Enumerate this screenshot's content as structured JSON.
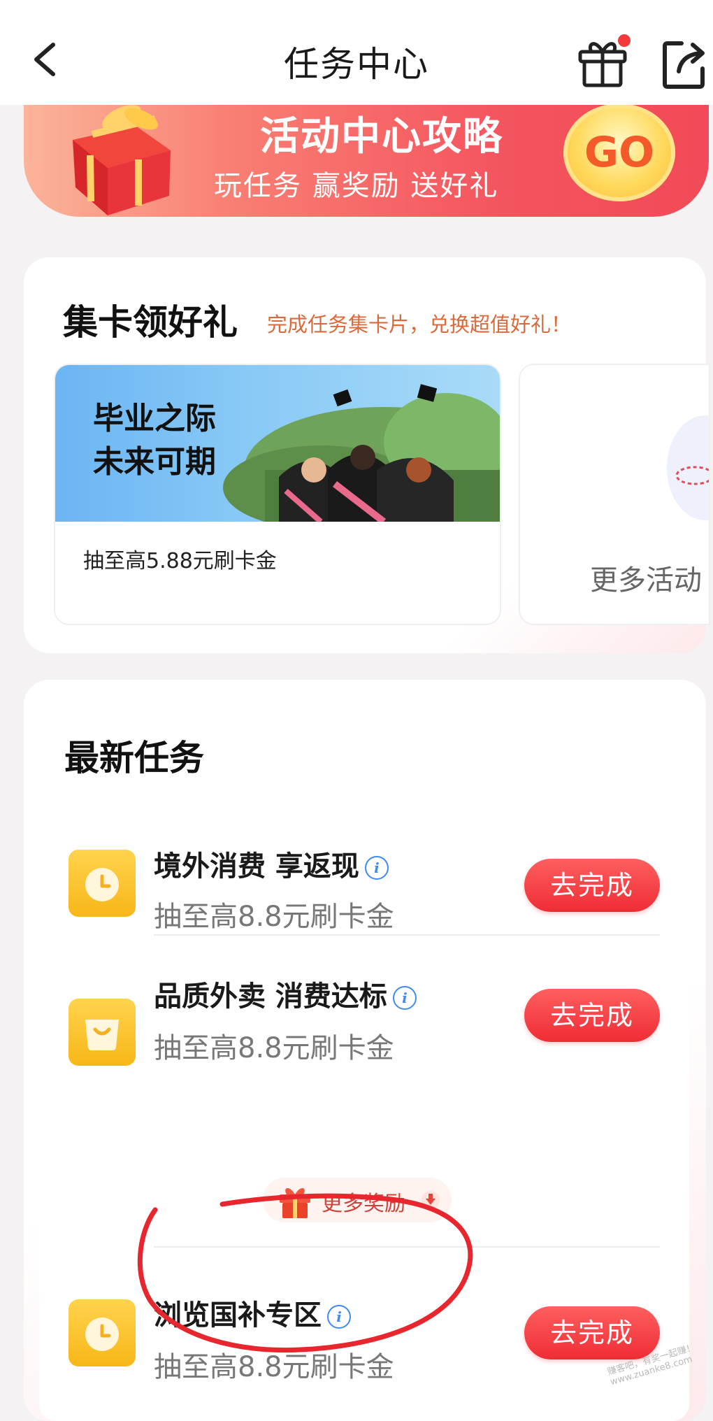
{
  "header": {
    "title": "任务中心"
  },
  "banner": {
    "title": "活动中心攻略",
    "subtitle": "玩任务 赢奖励 送好礼",
    "go_label": "GO"
  },
  "collect_cards": {
    "title": "集卡领好礼",
    "subtitle": "完成任务集卡片，兑换超值好礼！",
    "activity": {
      "image_text_line1": "毕业之际",
      "image_text_line2": "未来可期",
      "description": "抽至高5.88元刷卡金"
    },
    "more_label": "更多活动"
  },
  "tasks": {
    "title": "最新任务",
    "items": [
      {
        "name": "境外消费 享返现",
        "description": "抽至高8.8元刷卡金",
        "button": "去完成",
        "icon": "clock-icon"
      },
      {
        "name": "品质外卖 消费达标",
        "description": "抽至高8.8元刷卡金",
        "button": "去完成",
        "icon": "shopping-bag-icon"
      },
      {
        "name": "浏览国补专区",
        "description": "抽至高8.8元刷卡金",
        "button": "去完成",
        "icon": "clock-icon"
      }
    ],
    "more_rewards_label": "更多奖励"
  },
  "watermark": "赚客吧，有奖一起赚！www.zuanke8.com",
  "colors": {
    "accent_red": "#ee2d35",
    "annotation_red": "#e8262e",
    "task_icon_yellow": "#f7b718"
  }
}
